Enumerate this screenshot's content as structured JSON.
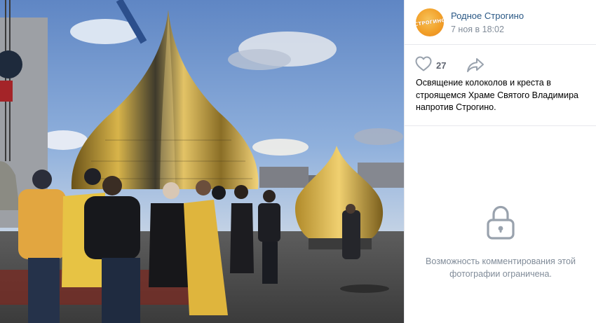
{
  "post": {
    "group_name": "Родное Строгино",
    "avatar_text": "СТРОГИНО",
    "date": "7 ноя в 18:02",
    "likes": "27",
    "description": "Освящение колоколов и креста в строящемся Храме Святого Владимира напротив Строгино."
  },
  "comments": {
    "restricted_message": "Возможность комментирования этой фотографии ограничена."
  },
  "icons": {
    "like": "heart-icon",
    "share": "share-arrow-icon",
    "lock": "lock-icon"
  },
  "colors": {
    "link": "#2a5885",
    "secondary_text": "#818c99",
    "icon": "#99a2ad",
    "divider": "#e7e8ec"
  }
}
